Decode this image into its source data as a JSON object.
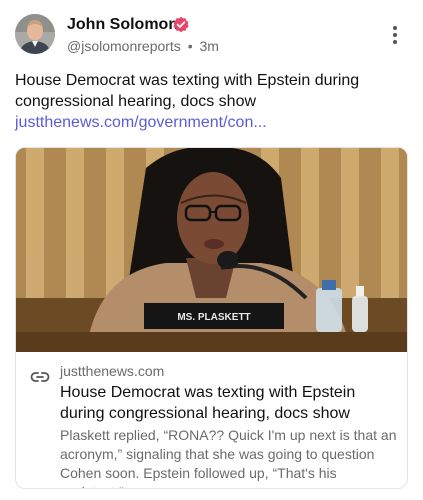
{
  "post": {
    "author": {
      "name": "John Solomon",
      "handle": "@jsolomonreports",
      "separator": "•",
      "time": "3m",
      "verified_color": "#e8456b"
    },
    "text": "House Democrat was texting with Epstein during congressional hearing, docs show",
    "link_text": "justthenews.com/government/con...",
    "link_color": "#5b5bd6"
  },
  "card": {
    "nameplate": "MS. PLASKETT",
    "domain": "justthenews.com",
    "title": "House Democrat was texting with Epstein during congressional hearing, docs show",
    "description": "Plaskett replied, “RONA?? Quick I'm up next is that an acronym,” signaling that she was going to question Cohen soon. Epstein followed up, “That's his assistant.”"
  }
}
